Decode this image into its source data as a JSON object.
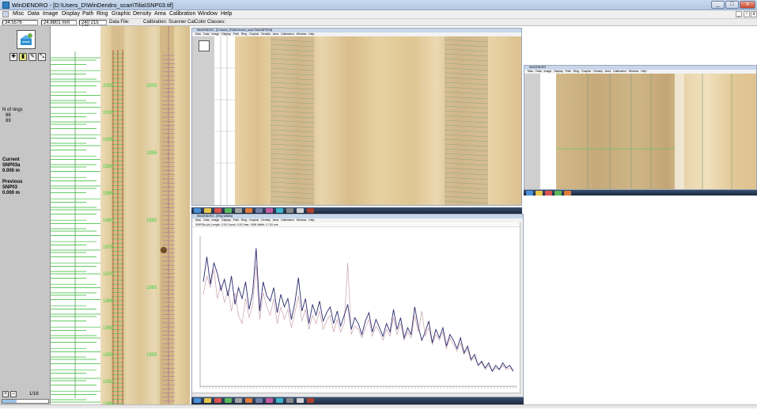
{
  "window": {
    "title": "WinDENDRO - [D:\\Users_D\\WinDendro_scan\\Tilia\\SNP03.tif]",
    "buttons": {
      "minimize": "_",
      "maximize": "□",
      "close": "x"
    }
  },
  "menubar": {
    "items": [
      "Misc",
      "Data",
      "Image",
      "Display",
      "Path",
      "Ring",
      "Graphic",
      "Density",
      "Area",
      "Calibration",
      "Window",
      "Help"
    ],
    "mdi_minimize": "_",
    "mdi_restore": "▫",
    "mdi_close": "x"
  },
  "statusbar": {
    "value1": "34.5576",
    "value2": "24.8801 mm",
    "value3": "240 215 175",
    "data_file_label": "Data File:",
    "calibration": "Calibration: Scanner Cal",
    "color_classes": "Color Classes:"
  },
  "leftpanel": {
    "n_rings_label": "N of rings",
    "n_rings_value1": "86",
    "n_rings_value2": "89",
    "current_label": "Current",
    "current_name": "SNP03a",
    "current_value": "0.000 m",
    "previous_label": "Previous",
    "previous_name": "SNP03",
    "previous_value": "0.000 m",
    "page_indicator": "1/16",
    "zoom_in_label": "+",
    "zoom_out_label": "−"
  },
  "core_strip": {
    "year_labels": [
      "2005",
      "2000",
      "1995",
      "1990",
      "1985",
      "1980",
      "1975",
      "1970",
      "1965",
      "1960",
      "1955",
      "1950",
      "1945"
    ]
  },
  "sub_windows": {
    "top_middle": {
      "title": "WinDENDRO - [D:\\Users_D\\WinDendro_scan\\Tilia\\SNP03.tif]",
      "menu": "Misc Data Image Display Path Ring Graphic Density Area Calibration Window Help"
    },
    "top_right": {
      "title": "WinDENDRO",
      "menu": "Misc Data Image Display Path Ring Graphic Density Area Calibration Window Help"
    },
    "graph": {
      "title": "WinDENDRO - [Ring Widths]",
      "menu": "Misc Data Image Display Path Ring Graphic Density Area Calibration Window Help",
      "info": "SNP03a (m)   Length: 0.00   Cumul: 0.00   Year: 1955   Width: 0.743 mm"
    }
  },
  "chart_data": {
    "type": "line",
    "series": [
      {
        "color": "#2a2a6e",
        "values": [
          1.55,
          1.85,
          1.52,
          1.78,
          1.65,
          1.45,
          1.58,
          1.38,
          1.62,
          1.28,
          1.48,
          1.35,
          1.55,
          1.22,
          1.42,
          1.95,
          1.2,
          1.55,
          1.38,
          1.32,
          1.48,
          1.18,
          1.4,
          1.25,
          1.35,
          1.1,
          1.3,
          1.6,
          1.2,
          1.35,
          1.05,
          1.28,
          1.15,
          1.32,
          1.08,
          1.18,
          1.25,
          1.05,
          1.2,
          1.02,
          1.15,
          1.28,
          0.98,
          1.12,
          1.05,
          0.92,
          1.08,
          1.18,
          0.95,
          1.1,
          1.0,
          0.9,
          1.05,
          0.95,
          1.22,
          0.98,
          1.12,
          0.88,
          1.0,
          0.92,
          1.25,
          1.02,
          0.85,
          0.95,
          1.08,
          0.82,
          0.98,
          0.88,
          1.0,
          0.78,
          0.92,
          0.85,
          0.75,
          0.88,
          0.7,
          0.78,
          0.62,
          0.68,
          0.55,
          0.6,
          0.52,
          0.58,
          0.48,
          0.55,
          0.5,
          0.58,
          0.52,
          0.55,
          0.48
        ]
      },
      {
        "color": "#c9a3ad",
        "values": [
          1.4,
          1.62,
          1.48,
          1.7,
          1.35,
          1.52,
          1.3,
          1.45,
          1.2,
          1.42,
          1.15,
          1.05,
          1.35,
          1.12,
          1.28,
          1.75,
          1.1,
          1.42,
          1.25,
          1.15,
          1.35,
          1.05,
          1.25,
          1.1,
          1.22,
          1.0,
          1.18,
          1.38,
          1.08,
          1.22,
          0.98,
          1.15,
          1.05,
          1.2,
          0.98,
          1.08,
          1.15,
          0.95,
          1.1,
          0.95,
          1.05,
          1.78,
          0.92,
          1.02,
          0.98,
          0.88,
          1.0,
          1.1,
          0.9,
          1.02,
          0.95,
          0.85,
          0.98,
          0.9,
          1.12,
          0.92,
          1.05,
          0.85,
          0.95,
          0.88,
          1.15,
          0.95,
          1.2,
          0.9,
          1.0,
          0.8,
          0.92,
          0.85,
          0.95,
          0.75,
          0.88,
          0.8,
          0.72,
          0.82,
          0.68,
          0.75,
          0.6,
          0.65,
          0.55,
          0.58,
          0.5,
          0.55,
          0.48,
          0.52,
          0.5,
          0.55,
          0.5,
          0.52,
          0.48
        ]
      }
    ],
    "ylim": [
      0.3,
      2.1
    ]
  }
}
